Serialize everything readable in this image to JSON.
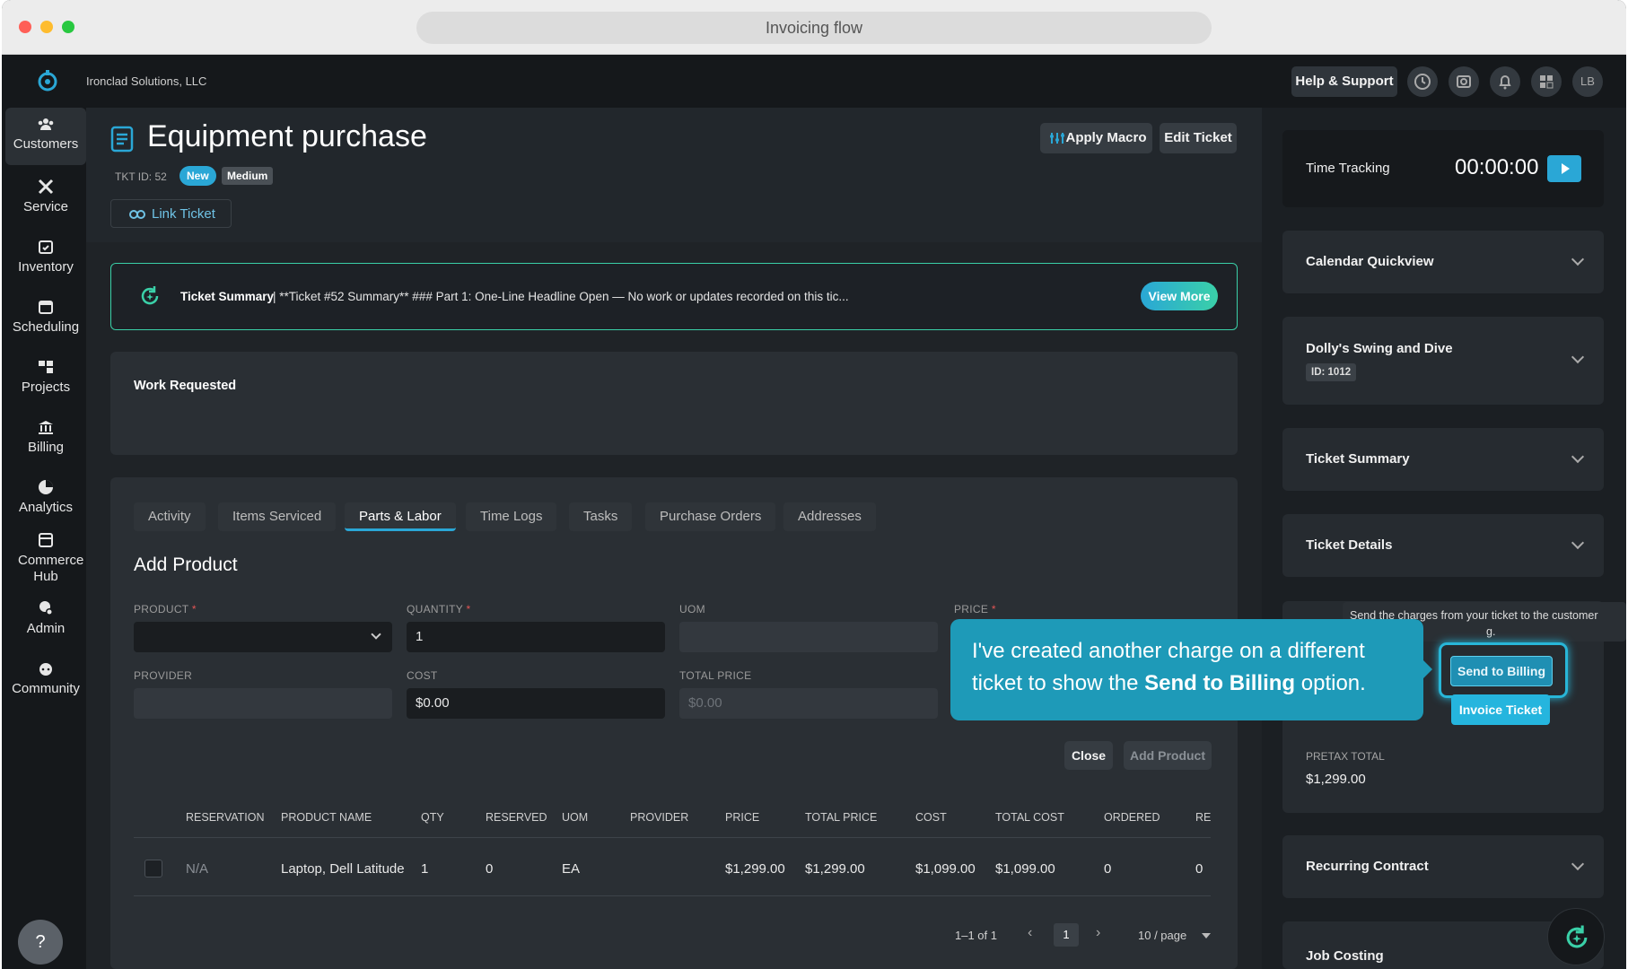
{
  "browser": {
    "title": "Invoicing flow"
  },
  "topbar": {
    "company": "Ironclad Solutions, LLC",
    "help": "Help & Support",
    "avatar": "LB"
  },
  "sidebar": {
    "items": [
      {
        "label": "Customers",
        "icon": "customers-icon"
      },
      {
        "label": "Service",
        "icon": "service-icon"
      },
      {
        "label": "Inventory",
        "icon": "inventory-icon"
      },
      {
        "label": "Scheduling",
        "icon": "calendar-icon"
      },
      {
        "label": "Projects",
        "icon": "projects-icon"
      },
      {
        "label": "Billing",
        "icon": "bank-icon"
      },
      {
        "label": "Analytics",
        "icon": "pie-chart-icon"
      },
      {
        "label": "Commerce Hub",
        "icon": "store-icon"
      },
      {
        "label": "Admin",
        "icon": "admin-icon"
      },
      {
        "label": "Community",
        "icon": "community-icon"
      }
    ],
    "help_glyph": "?"
  },
  "ticket": {
    "title": "Equipment purchase",
    "id": "TKT ID: 52",
    "status": "New",
    "priority": "Medium",
    "link": "Link Ticket",
    "apply_macro": "Apply Macro",
    "edit": "Edit Ticket"
  },
  "summary": {
    "label": "Ticket Summary",
    "text": " | **Ticket #52 Summary** ### Part 1: One-Line Headline Open — No work or updates recorded on this tic...",
    "view_more": "View More"
  },
  "work_requested": "Work Requested",
  "tabs": [
    "Activity",
    "Items Serviced",
    "Parts & Labor",
    "Time Logs",
    "Tasks",
    "Purchase Orders",
    "Addresses"
  ],
  "form": {
    "heading": "Add Product",
    "product_label": "PRODUCT",
    "quantity_label": "QUANTITY",
    "quantity_value": "1",
    "uom_label": "UOM",
    "price_label": "PRICE",
    "req": "*",
    "provider_label": "PROVIDER",
    "cost_label": "COST",
    "cost_value": "$0.00",
    "total_price_label": "TOTAL PRICE",
    "total_price_value": "$0.00",
    "close": "Close",
    "add": "Add Product"
  },
  "table": {
    "headers": [
      "RESERVATION",
      "PRODUCT NAME",
      "QTY",
      "RESERVED",
      "UOM",
      "PROVIDER",
      "PRICE",
      "TOTAL PRICE",
      "COST",
      "TOTAL COST",
      "ORDERED",
      "RE"
    ],
    "row": [
      "N/A",
      "Laptop, Dell Latitude",
      "1",
      "0",
      "EA",
      "",
      "$1,299.00",
      "$1,299.00",
      "$1,099.00",
      "$1,099.00",
      "0",
      "0"
    ],
    "pagination": {
      "range": "1–1 of 1",
      "page": "1",
      "per_page": "10 / page"
    }
  },
  "right": {
    "time_tracking": "Time Tracking",
    "timer": "00:00:00",
    "calendar": "Calendar Quickview",
    "customer": "Dolly's Swing and Dive",
    "customer_id": "ID: 1012",
    "ticket_summary": "Ticket Summary",
    "ticket_details": "Ticket Details",
    "tooltip": "Send the charges from your ticket to the customer",
    "tooltip_tail": "g.",
    "send_billing": "Send to Billing",
    "invoice": "Invoice Ticket",
    "pretax_label": "PRETAX TOTAL",
    "pretax_value": "$1,299.00",
    "recurring": "Recurring Contract",
    "job_costing": "Job Costing"
  },
  "callout": {
    "before": "I've created another charge on a different ticket to show the ",
    "strong": "Send to Billing",
    "after": " option."
  },
  "colors": {
    "accent": "#2aa7d6",
    "callout": "#1e9ab8",
    "status_new": "#2aa7d6",
    "summary_border": "#3ad0a8"
  }
}
